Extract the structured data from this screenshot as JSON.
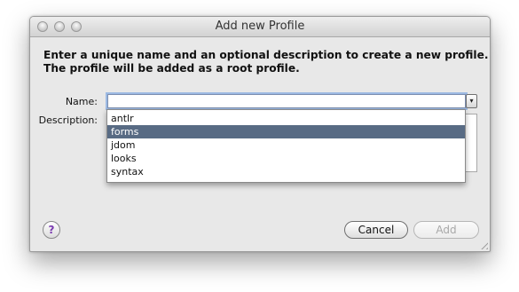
{
  "window": {
    "title": "Add new Profile"
  },
  "intro": {
    "line1": "Enter a unique name and an optional description to create a new profile.",
    "line2": "The profile will be added as a root profile."
  },
  "form": {
    "name_label": "Name:",
    "name_value": "",
    "description_label": "Description:",
    "dropdown_arrow": "▾"
  },
  "dropdown": {
    "selected": "forms",
    "items": [
      "antlr",
      "forms",
      "jdom",
      "looks",
      "syntax"
    ]
  },
  "buttons": {
    "help": "?",
    "cancel": "Cancel",
    "add": "Add"
  },
  "colors": {
    "selection": "#586b84",
    "focus_ring": "#9dbae3",
    "help_glyph": "#7a3ab0"
  },
  "icons": {
    "help": "help-icon",
    "dropdown": "chevron-down-icon",
    "resize": "resize-grip-icon"
  }
}
